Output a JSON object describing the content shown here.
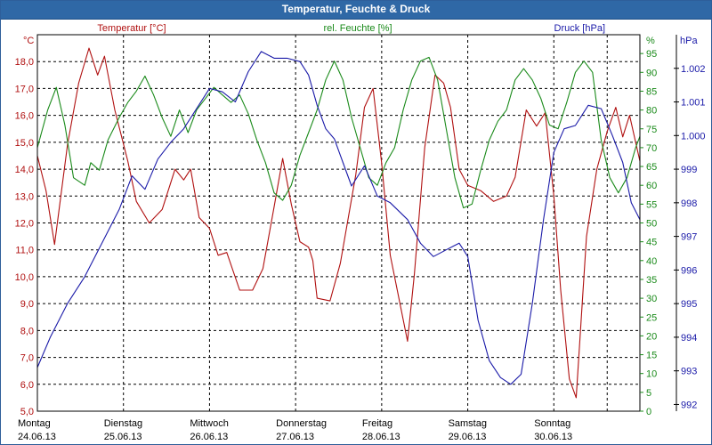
{
  "window": {
    "title": "Temperatur, Feuchte & Druck"
  },
  "chart_data": {
    "type": "line",
    "title": "Temperatur, Feuchte & Druck",
    "grid": true,
    "x_ticks": [
      {
        "day": "Montag",
        "date": "24.06.13"
      },
      {
        "day": "Dienstag",
        "date": "25.06.13"
      },
      {
        "day": "Mittwoch",
        "date": "26.06.13"
      },
      {
        "day": "Donnerstag",
        "date": "27.06.13"
      },
      {
        "day": "Freitag",
        "date": "28.06.13"
      },
      {
        "day": "Samstag",
        "date": "29.06.13"
      },
      {
        "day": "Sonntag",
        "date": "30.06.13"
      }
    ],
    "x_range_days": [
      0,
      7
    ],
    "axes": {
      "temperature": {
        "unit": "°C",
        "label": "Temperatur [°C]",
        "range": [
          5.0,
          19.0
        ],
        "ticks": [
          "5,0",
          "6,0",
          "7,0",
          "8,0",
          "9,0",
          "10,0",
          "11,0",
          "12,0",
          "13,0",
          "14,0",
          "15,0",
          "16,0",
          "17,0",
          "18,0"
        ],
        "color": "#b01010"
      },
      "humidity": {
        "unit": "%",
        "label": "rel. Feuchte [%]",
        "range": [
          0,
          100
        ],
        "ticks": [
          "0",
          "5",
          "10",
          "15",
          "20",
          "25",
          "30",
          "35",
          "40",
          "45",
          "50",
          "55",
          "60",
          "65",
          "70",
          "75",
          "80",
          "85",
          "90",
          "95"
        ],
        "color": "#1a8a1a"
      },
      "pressure": {
        "unit": "hPa",
        "label": "Druck [hPa]",
        "range": [
          991.8,
          1003.0
        ],
        "ticks": [
          "992",
          "993",
          "994",
          "995",
          "996",
          "997",
          "998",
          "999",
          "1.000",
          "1.001",
          "1.002"
        ],
        "color": "#1a1aa8"
      }
    },
    "series": [
      {
        "name": "Temperatur [°C]",
        "axis": "temperature",
        "color": "#b01010",
        "points": [
          [
            0,
            14.5
          ],
          [
            0.1,
            13.2
          ],
          [
            0.2,
            11.2
          ],
          [
            0.35,
            14.9
          ],
          [
            0.48,
            17.2
          ],
          [
            0.6,
            18.5
          ],
          [
            0.7,
            17.5
          ],
          [
            0.78,
            18.2
          ],
          [
            0.9,
            16.2
          ],
          [
            1.05,
            14.3
          ],
          [
            1.15,
            12.8
          ],
          [
            1.3,
            12.0
          ],
          [
            1.45,
            12.5
          ],
          [
            1.6,
            14.0
          ],
          [
            1.7,
            13.6
          ],
          [
            1.78,
            14.0
          ],
          [
            1.88,
            12.2
          ],
          [
            2.0,
            11.8
          ],
          [
            2.1,
            10.8
          ],
          [
            2.2,
            10.9
          ],
          [
            2.35,
            9.5
          ],
          [
            2.5,
            9.5
          ],
          [
            2.62,
            10.3
          ],
          [
            2.75,
            12.6
          ],
          [
            2.85,
            14.4
          ],
          [
            2.95,
            12.7
          ],
          [
            3.05,
            11.3
          ],
          [
            3.15,
            11.1
          ],
          [
            3.2,
            10.6
          ],
          [
            3.25,
            9.2
          ],
          [
            3.4,
            9.1
          ],
          [
            3.52,
            10.5
          ],
          [
            3.7,
            13.8
          ],
          [
            3.8,
            16.3
          ],
          [
            3.9,
            17.0
          ],
          [
            4.0,
            14.2
          ],
          [
            4.1,
            10.8
          ],
          [
            4.2,
            9.2
          ],
          [
            4.3,
            7.6
          ],
          [
            4.38,
            10.1
          ],
          [
            4.5,
            14.8
          ],
          [
            4.62,
            17.5
          ],
          [
            4.72,
            17.2
          ],
          [
            4.8,
            16.3
          ],
          [
            4.9,
            14.0
          ],
          [
            5.0,
            13.4
          ],
          [
            5.15,
            13.2
          ],
          [
            5.3,
            12.8
          ],
          [
            5.45,
            13.0
          ],
          [
            5.55,
            13.7
          ],
          [
            5.68,
            16.2
          ],
          [
            5.8,
            15.6
          ],
          [
            5.9,
            16.1
          ],
          [
            6.0,
            13.0
          ],
          [
            6.08,
            9.5
          ],
          [
            6.18,
            6.2
          ],
          [
            6.26,
            5.5
          ],
          [
            6.38,
            11.5
          ],
          [
            6.5,
            14.0
          ],
          [
            6.62,
            15.4
          ],
          [
            6.72,
            16.3
          ],
          [
            6.8,
            15.2
          ],
          [
            6.88,
            16.0
          ],
          [
            6.95,
            15.0
          ],
          [
            7.0,
            14.3
          ]
        ]
      },
      {
        "name": "rel. Feuchte [%]",
        "axis": "humidity",
        "color": "#1a8a1a",
        "points": [
          [
            0,
            70
          ],
          [
            0.12,
            80
          ],
          [
            0.22,
            86
          ],
          [
            0.32,
            76
          ],
          [
            0.42,
            62
          ],
          [
            0.55,
            60
          ],
          [
            0.62,
            66
          ],
          [
            0.72,
            64
          ],
          [
            0.82,
            72
          ],
          [
            0.95,
            78
          ],
          [
            1.05,
            82
          ],
          [
            1.15,
            85
          ],
          [
            1.25,
            89
          ],
          [
            1.35,
            84
          ],
          [
            1.45,
            78
          ],
          [
            1.55,
            73
          ],
          [
            1.65,
            80
          ],
          [
            1.75,
            74
          ],
          [
            1.85,
            80
          ],
          [
            1.95,
            83
          ],
          [
            2.05,
            86
          ],
          [
            2.15,
            84
          ],
          [
            2.25,
            82
          ],
          [
            2.35,
            84
          ],
          [
            2.45,
            79
          ],
          [
            2.55,
            72
          ],
          [
            2.65,
            66
          ],
          [
            2.75,
            58
          ],
          [
            2.85,
            56
          ],
          [
            2.95,
            60
          ],
          [
            3.05,
            68
          ],
          [
            3.15,
            74
          ],
          [
            3.25,
            80
          ],
          [
            3.35,
            88
          ],
          [
            3.45,
            93
          ],
          [
            3.55,
            88
          ],
          [
            3.65,
            78
          ],
          [
            3.75,
            70
          ],
          [
            3.85,
            62
          ],
          [
            3.95,
            60
          ],
          [
            4.05,
            66
          ],
          [
            4.15,
            70
          ],
          [
            4.25,
            80
          ],
          [
            4.35,
            88
          ],
          [
            4.45,
            93
          ],
          [
            4.55,
            94
          ],
          [
            4.65,
            88
          ],
          [
            4.75,
            75
          ],
          [
            4.85,
            62
          ],
          [
            4.95,
            54
          ],
          [
            5.05,
            55
          ],
          [
            5.15,
            64
          ],
          [
            5.25,
            72
          ],
          [
            5.35,
            77
          ],
          [
            5.45,
            80
          ],
          [
            5.55,
            88
          ],
          [
            5.65,
            91
          ],
          [
            5.75,
            88
          ],
          [
            5.85,
            83
          ],
          [
            5.95,
            76
          ],
          [
            6.05,
            75
          ],
          [
            6.15,
            82
          ],
          [
            6.25,
            90
          ],
          [
            6.35,
            93
          ],
          [
            6.45,
            90
          ],
          [
            6.55,
            72
          ],
          [
            6.65,
            62
          ],
          [
            6.75,
            58
          ],
          [
            6.85,
            62
          ],
          [
            6.95,
            70
          ],
          [
            7.0,
            73
          ]
        ]
      },
      {
        "name": "Druck [hPa]",
        "axis": "pressure",
        "color": "#1a1aa8",
        "points": [
          [
            0,
            993.1
          ],
          [
            0.15,
            994.0
          ],
          [
            0.35,
            995.0
          ],
          [
            0.55,
            995.8
          ],
          [
            0.75,
            996.8
          ],
          [
            0.95,
            997.8
          ],
          [
            1.1,
            998.8
          ],
          [
            1.25,
            998.4
          ],
          [
            1.4,
            999.3
          ],
          [
            1.55,
            999.8
          ],
          [
            1.7,
            1000.2
          ],
          [
            1.85,
            1000.8
          ],
          [
            2.0,
            1001.4
          ],
          [
            2.15,
            1001.3
          ],
          [
            2.3,
            1001.0
          ],
          [
            2.45,
            1001.9
          ],
          [
            2.6,
            1002.5
          ],
          [
            2.75,
            1002.3
          ],
          [
            2.9,
            1002.3
          ],
          [
            3.05,
            1002.2
          ],
          [
            3.15,
            1001.8
          ],
          [
            3.25,
            1000.9
          ],
          [
            3.35,
            1000.2
          ],
          [
            3.45,
            999.9
          ],
          [
            3.55,
            999.2
          ],
          [
            3.65,
            998.5
          ],
          [
            3.8,
            999.1
          ],
          [
            3.95,
            998.2
          ],
          [
            4.1,
            998.0
          ],
          [
            4.3,
            997.5
          ],
          [
            4.45,
            996.8
          ],
          [
            4.6,
            996.4
          ],
          [
            4.75,
            996.6
          ],
          [
            4.9,
            996.8
          ],
          [
            5.0,
            996.4
          ],
          [
            5.12,
            994.5
          ],
          [
            5.25,
            993.3
          ],
          [
            5.38,
            992.8
          ],
          [
            5.5,
            992.6
          ],
          [
            5.62,
            992.9
          ],
          [
            5.75,
            995.0
          ],
          [
            5.88,
            997.5
          ],
          [
            6.0,
            999.5
          ],
          [
            6.12,
            1000.2
          ],
          [
            6.25,
            1000.3
          ],
          [
            6.4,
            1000.9
          ],
          [
            6.55,
            1000.8
          ],
          [
            6.68,
            1000.0
          ],
          [
            6.8,
            999.2
          ],
          [
            6.9,
            998.0
          ],
          [
            7.0,
            997.5
          ]
        ]
      }
    ]
  }
}
